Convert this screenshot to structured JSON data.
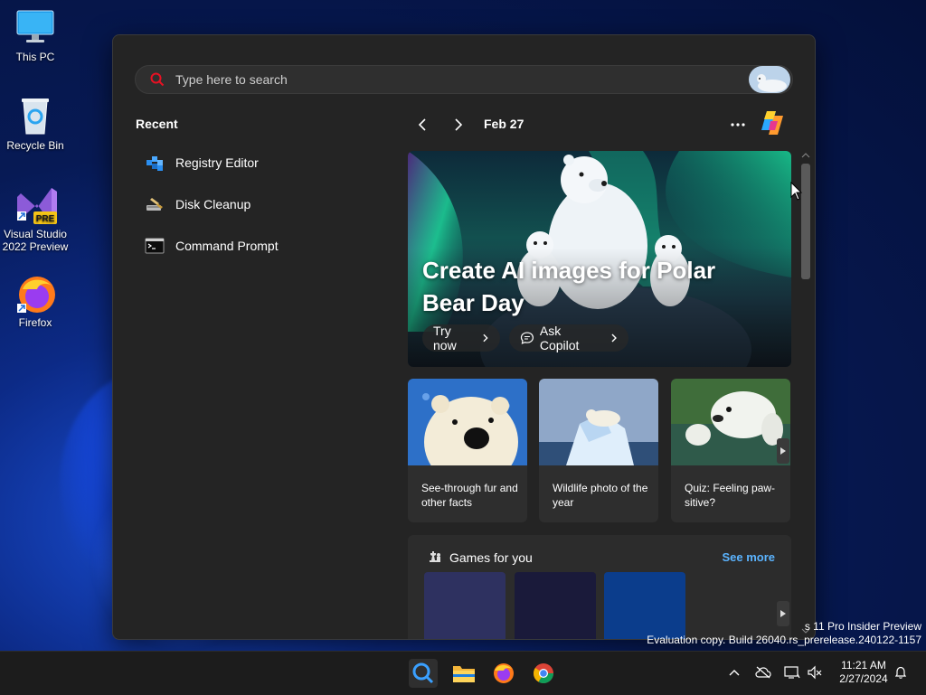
{
  "desktop": {
    "icons": [
      {
        "label": "This PC"
      },
      {
        "label": "Recycle Bin"
      },
      {
        "label": "Visual Studio 2022 Preview",
        "badge": "PRE"
      },
      {
        "label": "Firefox"
      }
    ]
  },
  "start": {
    "search_placeholder": "Type here to search",
    "recent_title": "Recent",
    "recent_items": [
      {
        "label": "Registry Editor"
      },
      {
        "label": "Disk Cleanup"
      },
      {
        "label": "Command Prompt"
      }
    ],
    "date": "Feb 27",
    "hero": {
      "title": "Create AI images for Polar Bear Day",
      "try_now": "Try now",
      "ask_copilot": "Ask Copilot"
    },
    "cards": [
      {
        "caption": "See-through fur and other facts"
      },
      {
        "caption": "Wildlife photo of the year"
      },
      {
        "caption": "Quiz: Feeling paw-sitive?"
      }
    ],
    "games": {
      "title": "Games for you",
      "see_more": "See more",
      "tile_colors": [
        "#2e3160",
        "#1a1a3a",
        "#0b3d8c"
      ]
    }
  },
  "watermark": {
    "line1": "s 11 Pro Insider Preview",
    "line2": "Evaluation copy. Build 26040.rs_prerelease.240122-1157"
  },
  "taskbar": {
    "time": "11:21 AM",
    "date": "2/27/2024"
  },
  "colors": {
    "accent": "#5bb4ff",
    "panel": "#242424"
  }
}
